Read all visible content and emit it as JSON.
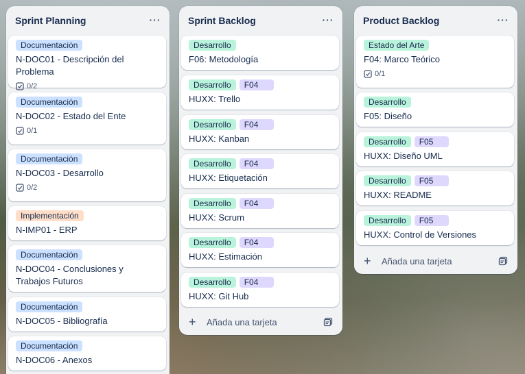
{
  "lists": [
    {
      "title": "Sprint Planning",
      "menu": "···",
      "cards": [
        {
          "labels": [
            {
              "text": "Documentación",
              "color": "blue"
            }
          ],
          "title": "N-DOC01 - Descripción del Problema",
          "checklist": "0/2"
        },
        {
          "labels": [
            {
              "text": "Documentación",
              "color": "blue"
            }
          ],
          "title": "N-DOC02 - Estado del Ente",
          "checklist": "0/1"
        },
        {
          "labels": [
            {
              "text": "Documentación",
              "color": "blue"
            }
          ],
          "title": "N-DOC03 - Desarrollo",
          "checklist": "0/2"
        },
        {
          "labels": [
            {
              "text": "Implementación",
              "color": "orange"
            }
          ],
          "title": "N-IMP01 - ERP"
        },
        {
          "labels": [
            {
              "text": "Documentación",
              "color": "blue"
            }
          ],
          "title": "N-DOC04 - Conclusiones y Trabajos Futuros"
        },
        {
          "labels": [
            {
              "text": "Documentación",
              "color": "blue"
            }
          ],
          "title": "N-DOC05 - Bibliografía"
        },
        {
          "labels": [
            {
              "text": "Documentación",
              "color": "blue"
            }
          ],
          "title": "N-DOC06 - Anexos"
        }
      ]
    },
    {
      "title": "Sprint Backlog",
      "menu": "···",
      "cards": [
        {
          "labels": [
            {
              "text": "Desarrollo",
              "color": "green"
            }
          ],
          "title": "F06: Metodología"
        },
        {
          "labels": [
            {
              "text": "Desarrollo",
              "color": "green"
            },
            {
              "text": "F04",
              "color": "purple"
            }
          ],
          "title": "HUXX: Trello"
        },
        {
          "labels": [
            {
              "text": "Desarrollo",
              "color": "green"
            },
            {
              "text": "F04",
              "color": "purple"
            }
          ],
          "title": "HUXX: Kanban"
        },
        {
          "labels": [
            {
              "text": "Desarrollo",
              "color": "green"
            },
            {
              "text": "F04",
              "color": "purple"
            }
          ],
          "title": "HUXX: Etiquetación"
        },
        {
          "labels": [
            {
              "text": "Desarrollo",
              "color": "green"
            },
            {
              "text": "F04",
              "color": "purple"
            }
          ],
          "title": "HUXX: Scrum"
        },
        {
          "labels": [
            {
              "text": "Desarrollo",
              "color": "green"
            },
            {
              "text": "F04",
              "color": "purple"
            }
          ],
          "title": "HUXX: Estimación"
        },
        {
          "labels": [
            {
              "text": "Desarrollo",
              "color": "green"
            },
            {
              "text": "F04",
              "color": "purple"
            }
          ],
          "title": "HUXX: Git Hub"
        }
      ],
      "add_card": "Añada una tarjeta"
    },
    {
      "title": "Product Backlog",
      "menu": "···",
      "cards": [
        {
          "labels": [
            {
              "text": "Estado del Arte",
              "color": "green"
            }
          ],
          "title": "F04: Marco Teórico",
          "checklist": "0/1"
        },
        {
          "labels": [
            {
              "text": "Desarrollo",
              "color": "green"
            }
          ],
          "title": "F05: Diseño"
        },
        {
          "labels": [
            {
              "text": "Desarrollo",
              "color": "green"
            },
            {
              "text": "F05",
              "color": "purple"
            }
          ],
          "title": "HUXX: Diseño UML"
        },
        {
          "labels": [
            {
              "text": "Desarrollo",
              "color": "green"
            },
            {
              "text": "F05",
              "color": "purple"
            }
          ],
          "title": "HUXX: README"
        },
        {
          "labels": [
            {
              "text": "Desarrollo",
              "color": "green"
            },
            {
              "text": "F05",
              "color": "purple"
            }
          ],
          "title": "HUXX: Control de Versiones"
        }
      ],
      "add_card": "Añada una tarjeta"
    }
  ],
  "colors": {
    "label_blue": "#cce0ff",
    "label_green": "#baf3db",
    "label_orange": "#fedec8",
    "label_purple": "#dfd8fd",
    "list_bg": "#f1f2f4"
  }
}
